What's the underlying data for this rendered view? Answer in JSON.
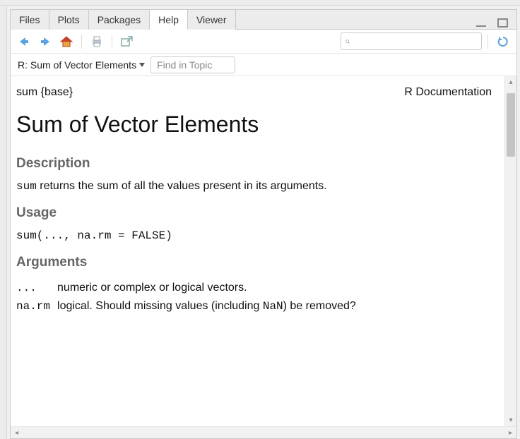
{
  "tabs": {
    "items": [
      "Files",
      "Plots",
      "Packages",
      "Help",
      "Viewer"
    ],
    "active": 3
  },
  "toolbar": {
    "search_placeholder": ""
  },
  "breadcrumb": "R: Sum of Vector Elements",
  "find_placeholder": "Find in Topic",
  "doc": {
    "sig": "sum {base}",
    "kind": "R Documentation",
    "title": "Sum of Vector Elements",
    "headings": {
      "description": "Description",
      "usage": "Usage",
      "arguments": "Arguments"
    },
    "description_parts": {
      "code": "sum",
      "rest": " returns the sum of all the values present in its arguments."
    },
    "usage": "sum(..., na.rm = FALSE)",
    "args": [
      {
        "name": "...",
        "desc": "numeric or complex or logical vectors."
      },
      {
        "name": "na.rm",
        "desc_pre": "logical. Should missing values (including ",
        "desc_code": "NaN",
        "desc_post": ") be removed?"
      }
    ]
  }
}
